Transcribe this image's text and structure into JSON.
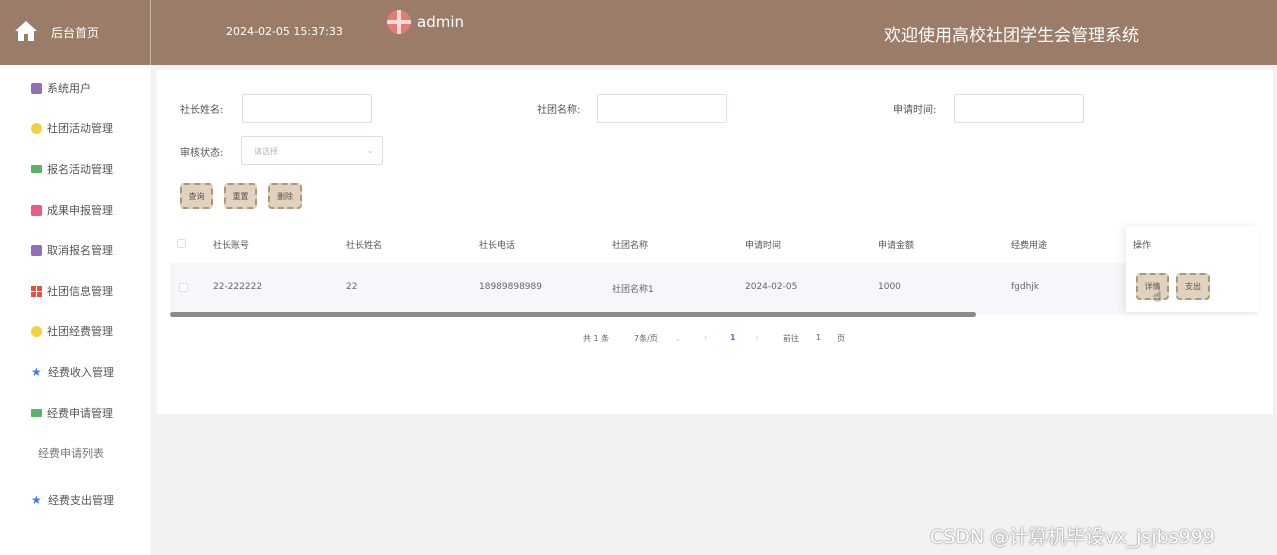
{
  "header": {
    "home_label": "后台首页",
    "datetime": "2024-02-05 15:37:33",
    "username": "admin",
    "title": "欢迎使用高校社团学生会管理系统"
  },
  "sidebar": {
    "items": [
      {
        "label": "系统用户",
        "icon": "database-icon"
      },
      {
        "label": "社团活动管理",
        "icon": "circle-icon"
      },
      {
        "label": "报名活动管理",
        "icon": "message-icon"
      },
      {
        "label": "成果申报管理",
        "icon": "document-icon"
      },
      {
        "label": "取消报名管理",
        "icon": "database-icon"
      },
      {
        "label": "社团信息管理",
        "icon": "grid-icon"
      },
      {
        "label": "社团经费管理",
        "icon": "circle-icon"
      },
      {
        "label": "经费收入管理",
        "icon": "star-icon"
      },
      {
        "label": "经费申请管理",
        "icon": "message-icon"
      },
      {
        "label": "经费支出管理",
        "icon": "star-icon"
      }
    ],
    "submenu_label": "经费申请列表"
  },
  "search": {
    "president_name_label": "社长姓名:",
    "club_name_label": "社团名称:",
    "apply_time_label": "申请时间:",
    "status_label": "审核状态:",
    "status_placeholder": "请选择",
    "query_button": "查询",
    "reset_button": "重置",
    "delete_button": "删除"
  },
  "table": {
    "headers": [
      "社长账号",
      "社长姓名",
      "社长电话",
      "社团名称",
      "申请时间",
      "申请金额",
      "经费用途",
      "操作"
    ],
    "rows": [
      {
        "account": "22-222222",
        "name": "22",
        "phone": "18989898989",
        "club": "社团名称1",
        "date": "2024-02-05",
        "amount": "1000",
        "purpose": "fgdhjk",
        "detail_button": "详情",
        "expense_button": "支出"
      }
    ]
  },
  "pagination": {
    "total": "共 1 条",
    "page_size": "7条/页",
    "current_page": "1",
    "goto_label": "前往",
    "goto_value": "1",
    "page_suffix": "页"
  },
  "watermark": "CSDN @计算机毕设vx_jsjbs999",
  "colors": {
    "header_bg": "#9a7c69",
    "button_bg": "#e0d2bd",
    "accent_blue": "#3f7de6"
  }
}
